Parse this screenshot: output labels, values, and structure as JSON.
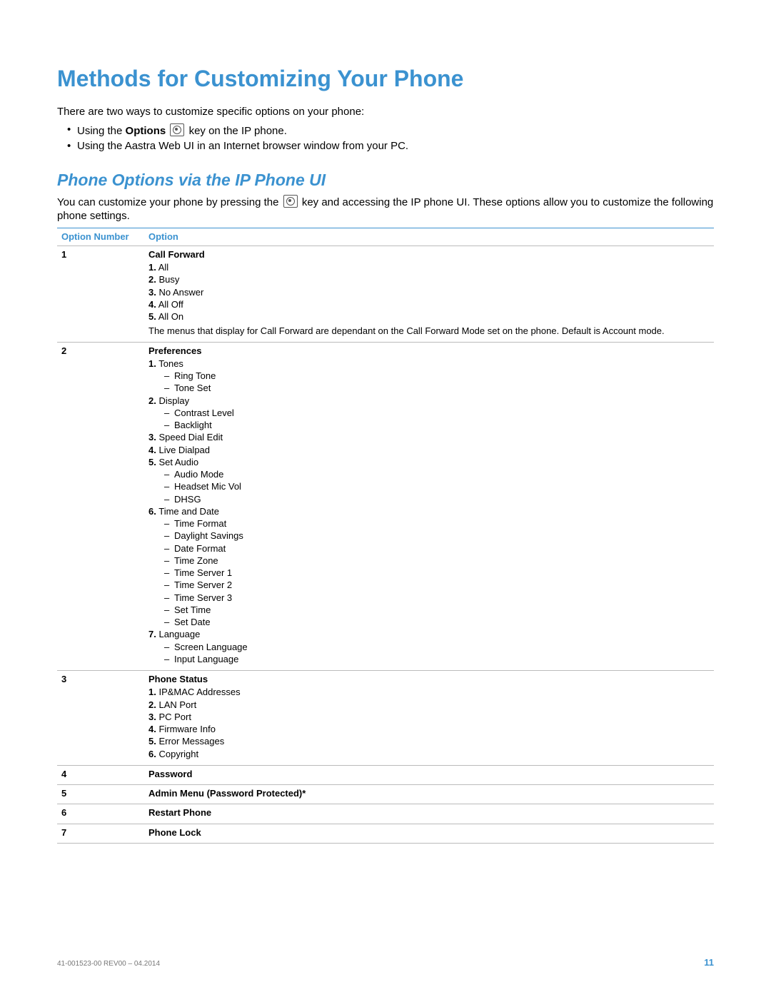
{
  "h1": "Methods for Customizing Your Phone",
  "intro": "There are two ways to customize specific options on your phone:",
  "bullet1_pre": "Using the ",
  "bullet1_bold": "Options",
  "bullet1_post": " key on the IP phone.",
  "bullet2": "Using the Aastra Web UI in an Internet browser window from your PC.",
  "h2": "Phone Options via the IP Phone UI",
  "para_pre": "You can customize your phone by pressing the ",
  "para_post": " key and accessing the IP phone UI. These options allow you to customize the following phone settings.",
  "th1": "Option Number",
  "th2": "Option",
  "row1": {
    "num": "1",
    "title": "Call Forward",
    "items": {
      "1": "All",
      "2": "Busy",
      "3": "No Answer",
      "4": "All Off",
      "5": "All On"
    },
    "note": "The menus that display for Call Forward are dependant on the Call Forward Mode set on the phone. Default is Account mode."
  },
  "row2": {
    "num": "2",
    "title": "Preferences",
    "i1": "Tones",
    "i1a": "Ring Tone",
    "i1b": "Tone Set",
    "i2": "Display",
    "i2a": "Contrast Level",
    "i2b": "Backlight",
    "i3": "Speed Dial Edit",
    "i4": "Live Dialpad",
    "i5": "Set Audio",
    "i5a": "Audio Mode",
    "i5b": "Headset Mic Vol",
    "i5c": "DHSG",
    "i6": "Time and Date",
    "i6a": "Time Format",
    "i6b": "Daylight Savings",
    "i6c": "Date Format",
    "i6d": "Time Zone",
    "i6e": "Time Server 1",
    "i6f": "Time Server 2",
    "i6g": "Time Server 3",
    "i6h": "Set Time",
    "i6i": "Set Date",
    "i7": "Language",
    "i7a": "Screen Language",
    "i7b": "Input Language"
  },
  "row3": {
    "num": "3",
    "title": "Phone Status",
    "items": {
      "1": "IP&MAC Addresses",
      "2": "LAN Port",
      "3": "PC Port",
      "4": "Firmware Info",
      "5": "Error Messages",
      "6": "Copyright"
    }
  },
  "row4": {
    "num": "4",
    "title": "Password"
  },
  "row5": {
    "num": "5",
    "title": "Admin Menu (Password Protected)*"
  },
  "row6": {
    "num": "6",
    "title": "Restart Phone"
  },
  "row7": {
    "num": "7",
    "title": "Phone Lock"
  },
  "footer_doc": "41-001523-00 REV00 – 04.2014",
  "footer_page": "11"
}
